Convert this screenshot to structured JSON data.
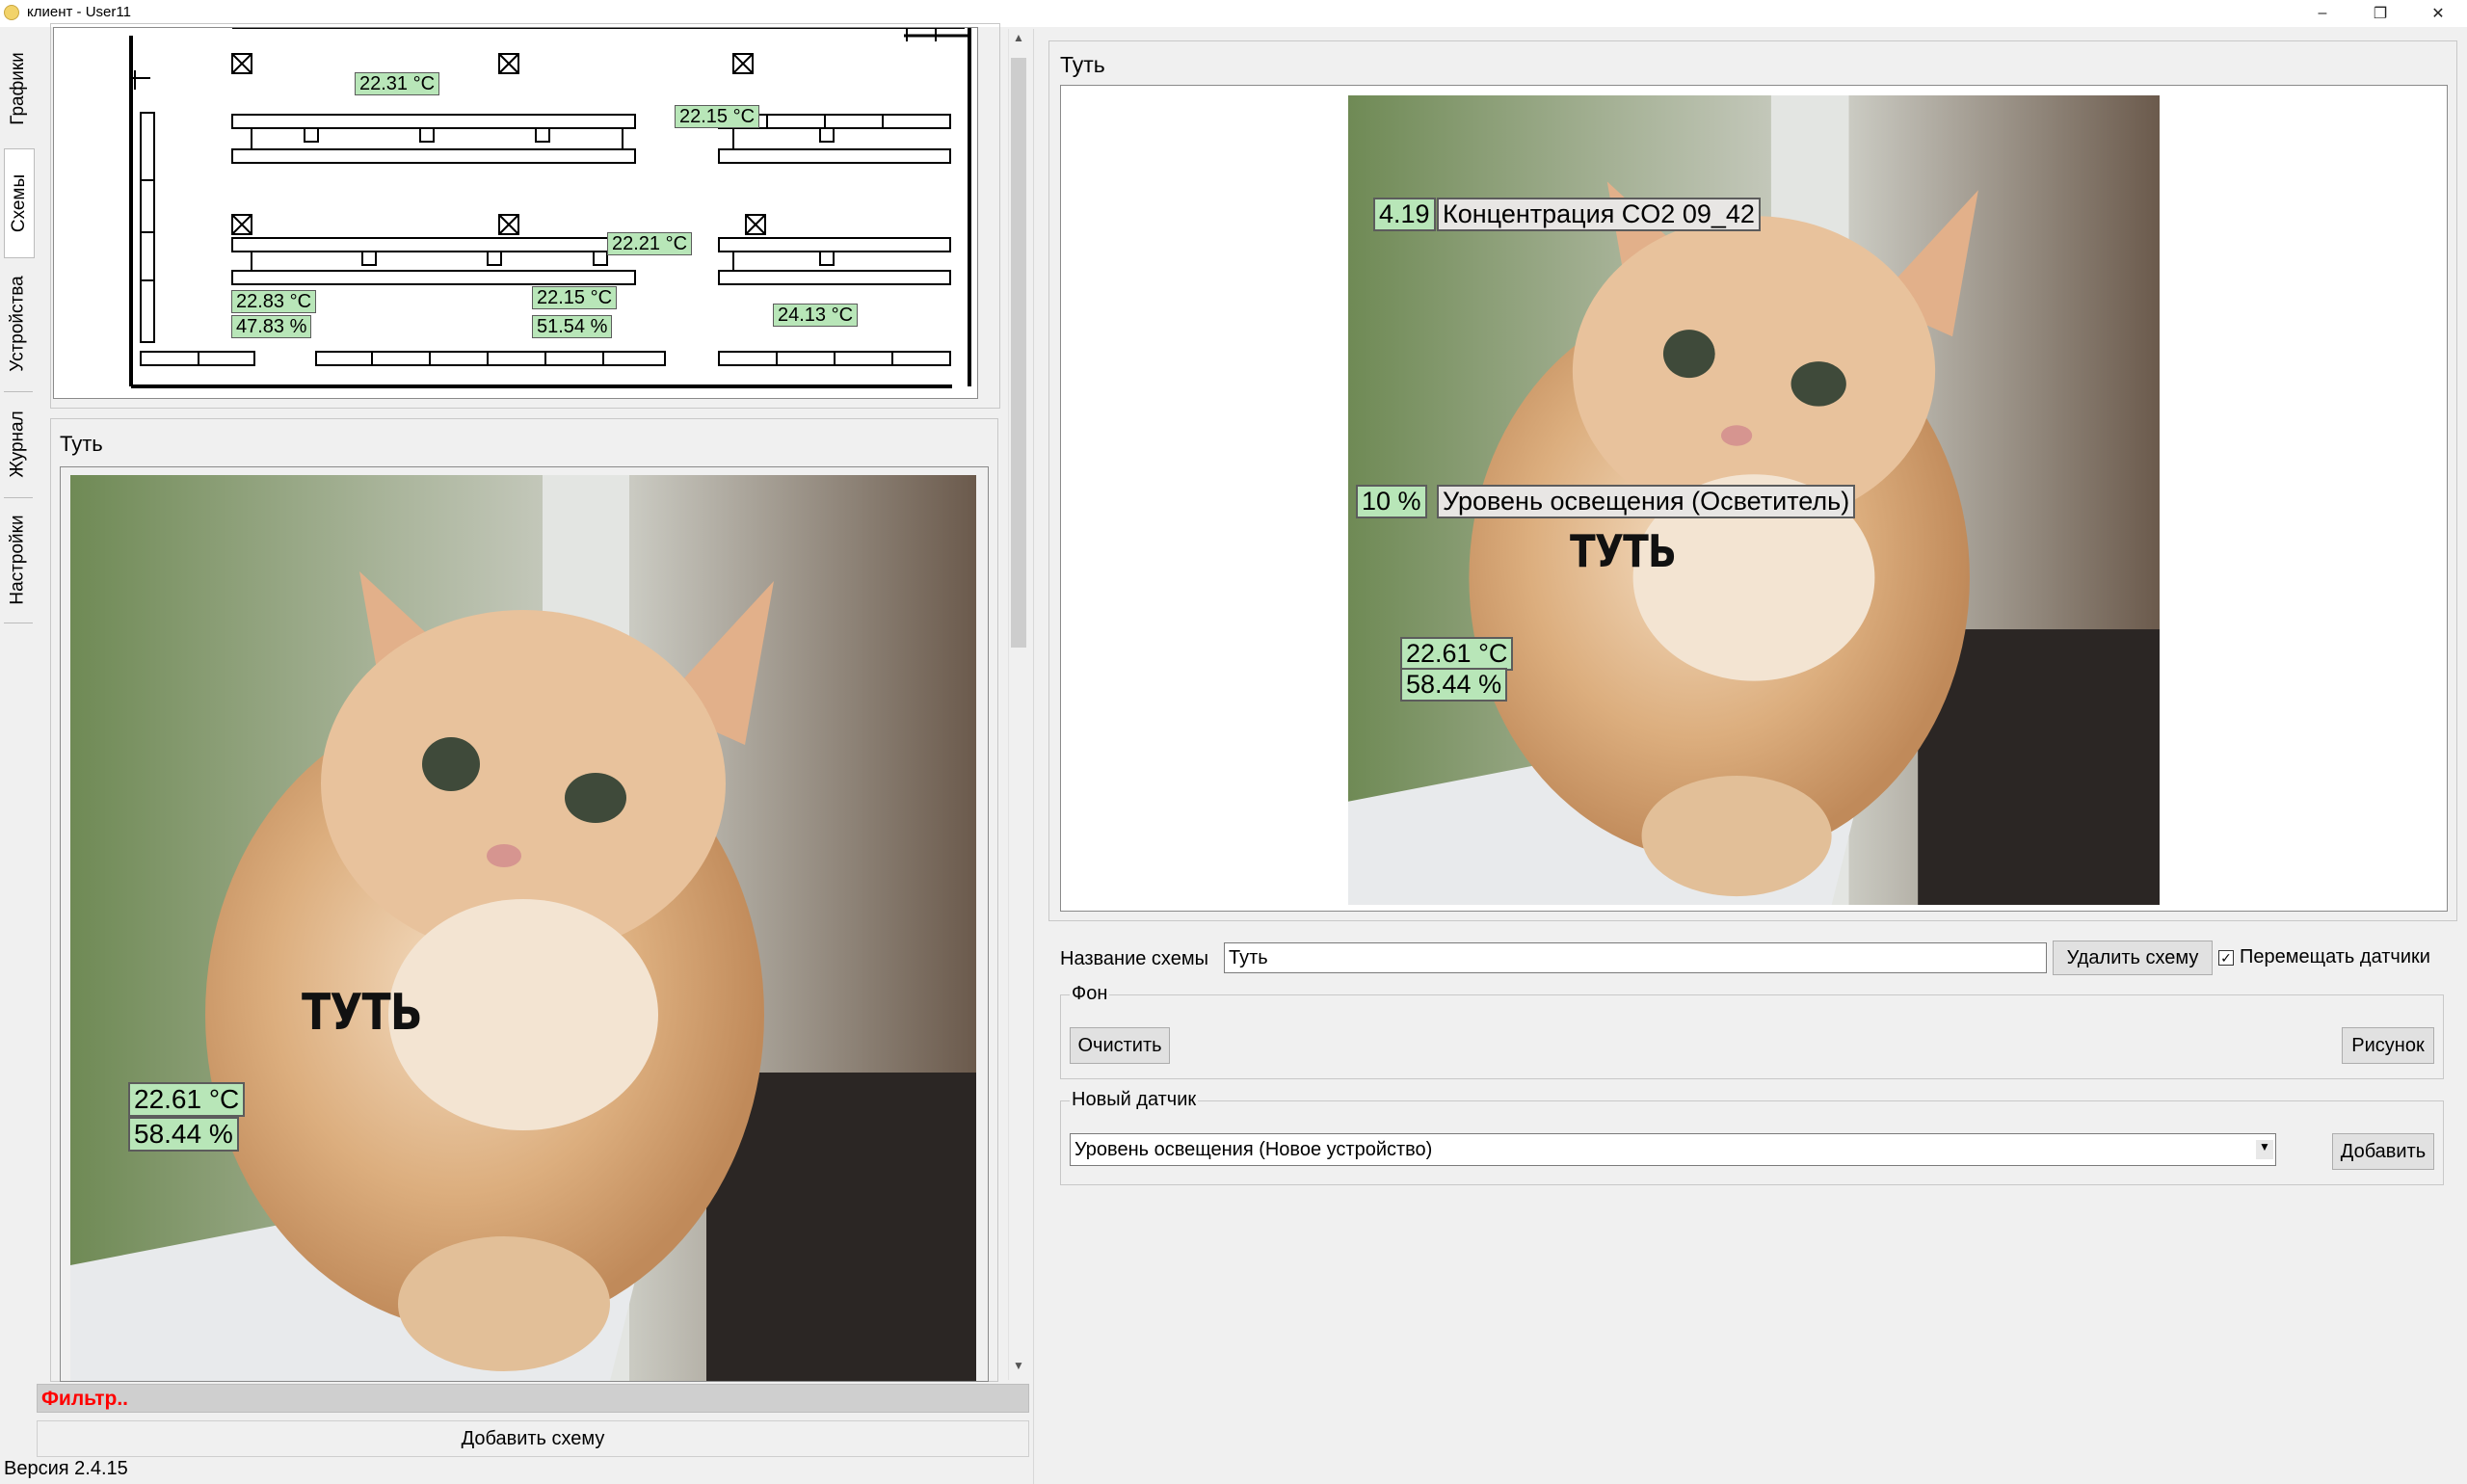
{
  "window": {
    "title": "клиент - User11",
    "minimize": "–",
    "maximize": "❐",
    "close": "✕"
  },
  "tabs": [
    "Графики",
    "Схемы",
    "Устройства",
    "Журнал",
    "Настройки"
  ],
  "floorplan": {
    "sensors": [
      "22.31 °C",
      "22.15 °C",
      "22.21 °C",
      "22.83 °C",
      "47.83 %",
      "22.15 °C",
      "51.54 %",
      "24.13 °C"
    ]
  },
  "left_scheme": {
    "title": "Туть",
    "overlay_text": "ТУТЬ",
    "sensors": [
      "22.61 °C",
      "58.44 %"
    ]
  },
  "filter": {
    "label": "Фильтр..",
    "color": "#ff0000"
  },
  "add_scheme_button": "Добавить схему",
  "version": "Версия 2.4.15",
  "editor": {
    "title": "Туть",
    "overlay_text": "ТУТЬ",
    "sensor_values": [
      "4.19",
      "10 %",
      "22.61 °C",
      "58.44 %"
    ],
    "sensor_names": [
      "Концентрация CO2 09_42",
      "Уровень освещения (Осветитель)"
    ],
    "scheme_name_label": "Название схемы",
    "scheme_name_value": "Туть",
    "delete_button": "Удалить схему",
    "move_sensors_checkbox": {
      "label": "Перемещать датчики",
      "checked": true,
      "mark": "✓"
    },
    "background_group": {
      "label": "Фон",
      "clear_button": "Очистить",
      "image_button": "Рисунок"
    },
    "new_sensor_group": {
      "label": "Новый датчик",
      "selected_option": "Уровень освещения (Новое устройство)",
      "add_button": "Добавить",
      "dropdown_arrow": "▼"
    }
  },
  "colors": {
    "sensor_bg": "#b8e6b8",
    "window_bg": "#f0f0f0",
    "filter_red": "#ff0000"
  }
}
